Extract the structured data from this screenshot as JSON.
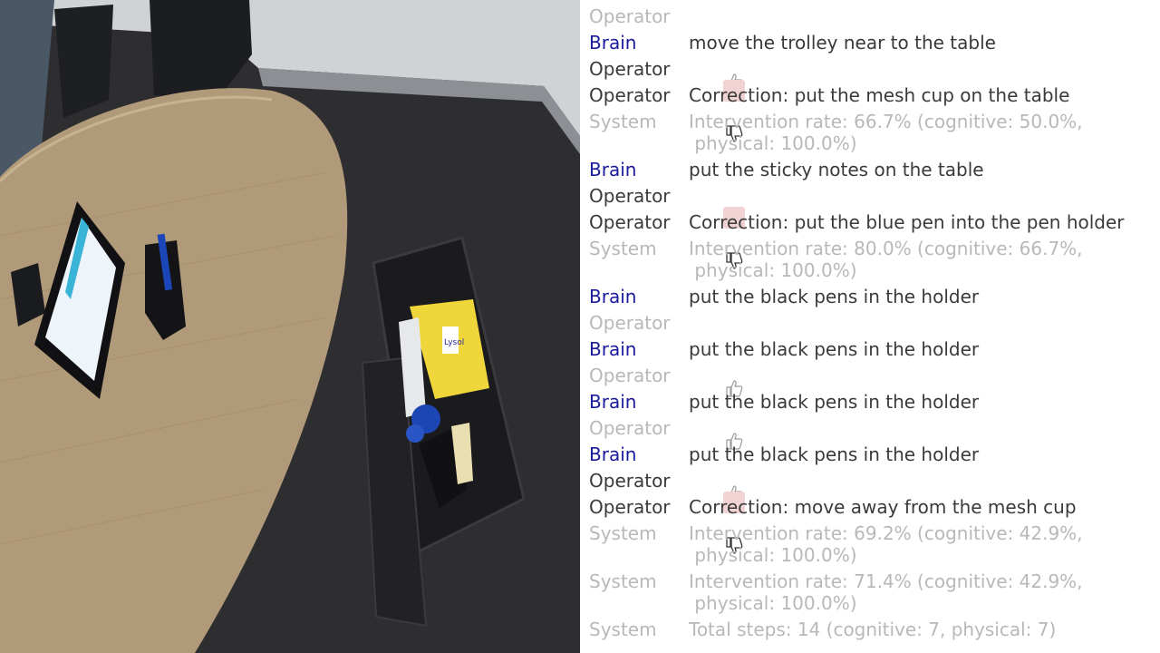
{
  "camera_view": {
    "label_text": "Lysol"
  },
  "log": {
    "rows": [
      {
        "speaker": "Operator",
        "type": "feedback",
        "feedback": "thumbs-up"
      },
      {
        "speaker": "Brain",
        "type": "text",
        "text": "move the trolley near to the table"
      },
      {
        "speaker": "Operator",
        "type": "feedback",
        "feedback": "thumbs-down"
      },
      {
        "speaker": "Operator",
        "type": "text",
        "text": "Correction: put the mesh cup on the table"
      },
      {
        "speaker": "System",
        "type": "system",
        "text": "Intervention rate: 66.7% (cognitive: 50.0%,\n physical: 100.0%)"
      },
      {
        "speaker": "Brain",
        "type": "text",
        "text": "put the sticky notes on the table"
      },
      {
        "speaker": "Operator",
        "type": "feedback",
        "feedback": "thumbs-down"
      },
      {
        "speaker": "Operator",
        "type": "text",
        "text": "Correction: put the blue pen into the pen holder"
      },
      {
        "speaker": "System",
        "type": "system",
        "text": "Intervention rate: 80.0% (cognitive: 66.7%,\n physical: 100.0%)"
      },
      {
        "speaker": "Brain",
        "type": "text",
        "text": "put the black pens in the holder"
      },
      {
        "speaker": "Operator",
        "type": "feedback",
        "feedback": "thumbs-up"
      },
      {
        "speaker": "Brain",
        "type": "text",
        "text": "put the black pens in the holder"
      },
      {
        "speaker": "Operator",
        "type": "feedback",
        "feedback": "thumbs-up"
      },
      {
        "speaker": "Brain",
        "type": "text",
        "text": "put the black pens in the holder"
      },
      {
        "speaker": "Operator",
        "type": "feedback",
        "feedback": "thumbs-up"
      },
      {
        "speaker": "Brain",
        "type": "text",
        "text": "put the black pens in the holder"
      },
      {
        "speaker": "Operator",
        "type": "feedback",
        "feedback": "thumbs-down"
      },
      {
        "speaker": "Operator",
        "type": "text",
        "text": "Correction: move away from the mesh cup"
      },
      {
        "speaker": "System",
        "type": "system",
        "text": "Intervention rate: 69.2% (cognitive: 42.9%,\n physical: 100.0%)"
      },
      {
        "speaker": "System",
        "type": "system",
        "text": "Intervention rate: 71.4% (cognitive: 42.9%,\n physical: 100.0%)"
      },
      {
        "speaker": "System",
        "type": "system",
        "text": "Total steps: 14 (cognitive: 7, physical: 7)"
      }
    ]
  }
}
